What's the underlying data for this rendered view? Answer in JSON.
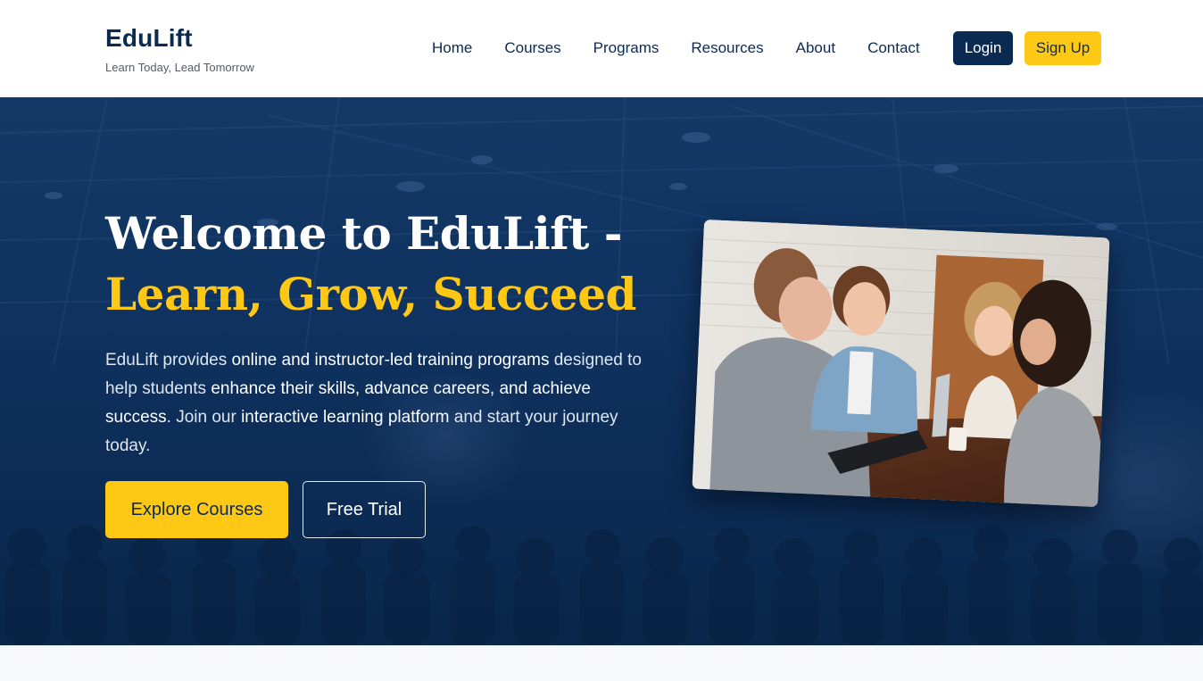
{
  "brand": {
    "name": "EduLift",
    "tagline": "Learn Today, Lead Tomorrow"
  },
  "nav": {
    "items": [
      {
        "label": "Home"
      },
      {
        "label": "Courses"
      },
      {
        "label": "Programs"
      },
      {
        "label": "Resources"
      },
      {
        "label": "About"
      },
      {
        "label": "Contact"
      }
    ],
    "login_label": "Login",
    "signup_label": "Sign Up"
  },
  "hero": {
    "title_line1": "Welcome to EduLift -",
    "title_line2": "Learn, Grow, Succeed",
    "desc_parts": [
      "EduLift provides ",
      "online and instructor-led training programs",
      " designed to help students ",
      "enhance their skills, advance careers, and achieve success",
      ". Join our ",
      "interactive learning platform",
      " and start your journey today."
    ],
    "primary_cta": "Explore Courses",
    "secondary_cta": "Free Trial",
    "image_alt": "students-collaborating-photo"
  },
  "colors": {
    "navy": "#0b2a52",
    "accent_yellow": "#ffc814",
    "white": "#ffffff"
  }
}
